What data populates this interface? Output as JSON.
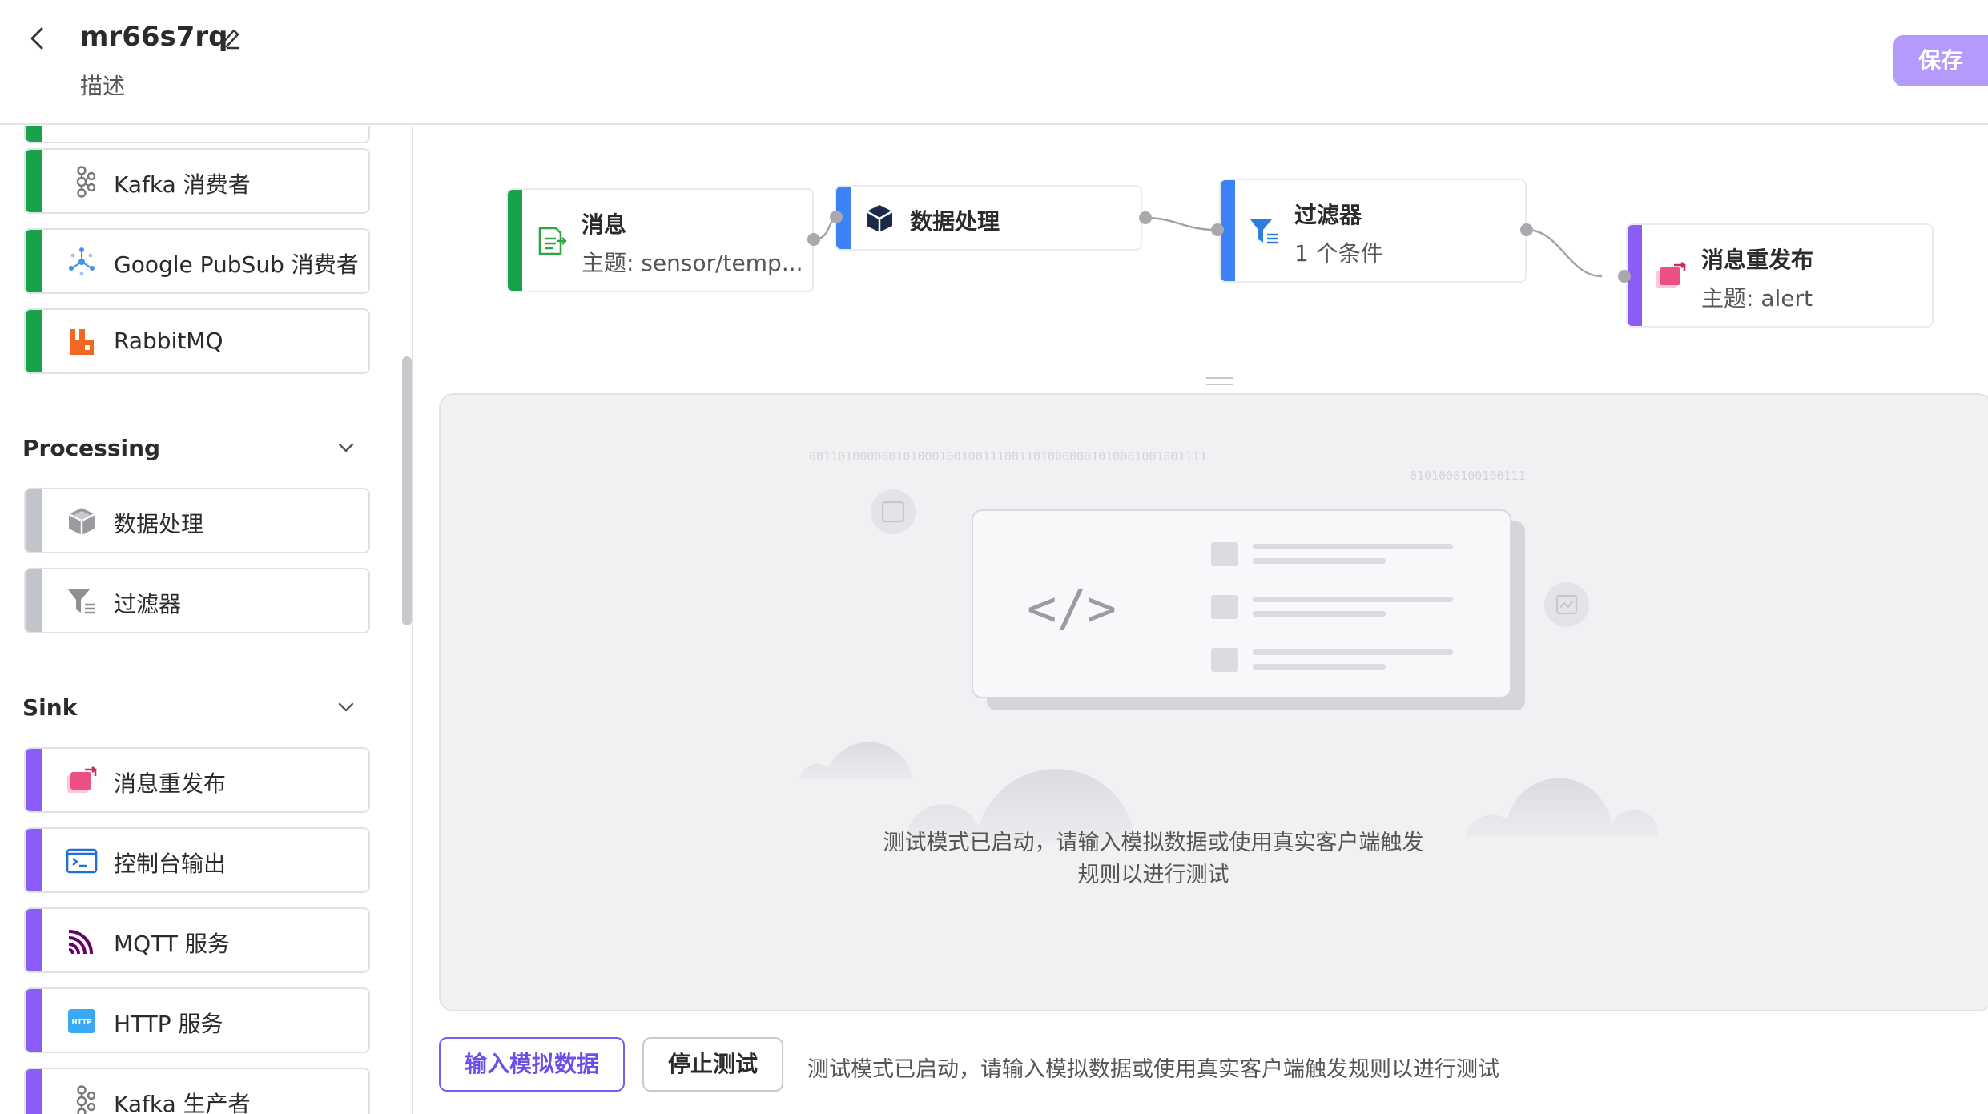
{
  "header": {
    "title": "mr66s7rq",
    "description": "描述",
    "save_label": "保存"
  },
  "sidebar": {
    "source_items": [
      {
        "label": "Kafka 消费者",
        "icon": "kafka-icon"
      },
      {
        "label": "Google PubSub 消费者",
        "icon": "pubsub-icon"
      },
      {
        "label": "RabbitMQ",
        "icon": "rabbitmq-icon"
      }
    ],
    "processing": {
      "title": "Processing",
      "items": [
        {
          "label": "数据处理",
          "icon": "cube-icon"
        },
        {
          "label": "过滤器",
          "icon": "filter-icon"
        }
      ]
    },
    "sink": {
      "title": "Sink",
      "items": [
        {
          "label": "消息重发布",
          "icon": "republish-icon"
        },
        {
          "label": "控制台输出",
          "icon": "console-icon"
        },
        {
          "label": "MQTT 服务",
          "icon": "mqtt-icon"
        },
        {
          "label": "HTTP 服务",
          "icon": "http-icon"
        },
        {
          "label": "Kafka 生产者",
          "icon": "kafka-icon"
        }
      ]
    }
  },
  "flow": {
    "nodes": [
      {
        "title": "消息",
        "subtitle": "主题: sensor/temp...",
        "icon": "message-icon",
        "color": "#18a34a"
      },
      {
        "title": "数据处理",
        "subtitle": "",
        "icon": "cube-icon",
        "color": "#3b82f6"
      },
      {
        "title": "过滤器",
        "subtitle": "1 个条件",
        "icon": "filter-icon",
        "color": "#3b82f6"
      },
      {
        "title": "消息重发布",
        "subtitle": "主题: alert",
        "icon": "republish-icon",
        "color": "#8b5cf6"
      }
    ]
  },
  "test_panel": {
    "binary_1": "0011010000001010001001001110011010000001010001001001111",
    "binary_2": "0101000100100111",
    "empty_message": "测试模式已启动，请输入模拟数据或使用真实客户端触发规则以进行测试"
  },
  "footer": {
    "mock_button": "输入模拟数据",
    "stop_button": "停止测试",
    "status": "测试模式已启动，请输入模拟数据或使用真实客户端触发规则以进行测试"
  },
  "colors": {
    "accent": "#8b5cf6",
    "save": "#b49afb",
    "source": "#18a34a",
    "processing_bar": "#c1c4cb",
    "node_blue": "#3b82f6"
  }
}
